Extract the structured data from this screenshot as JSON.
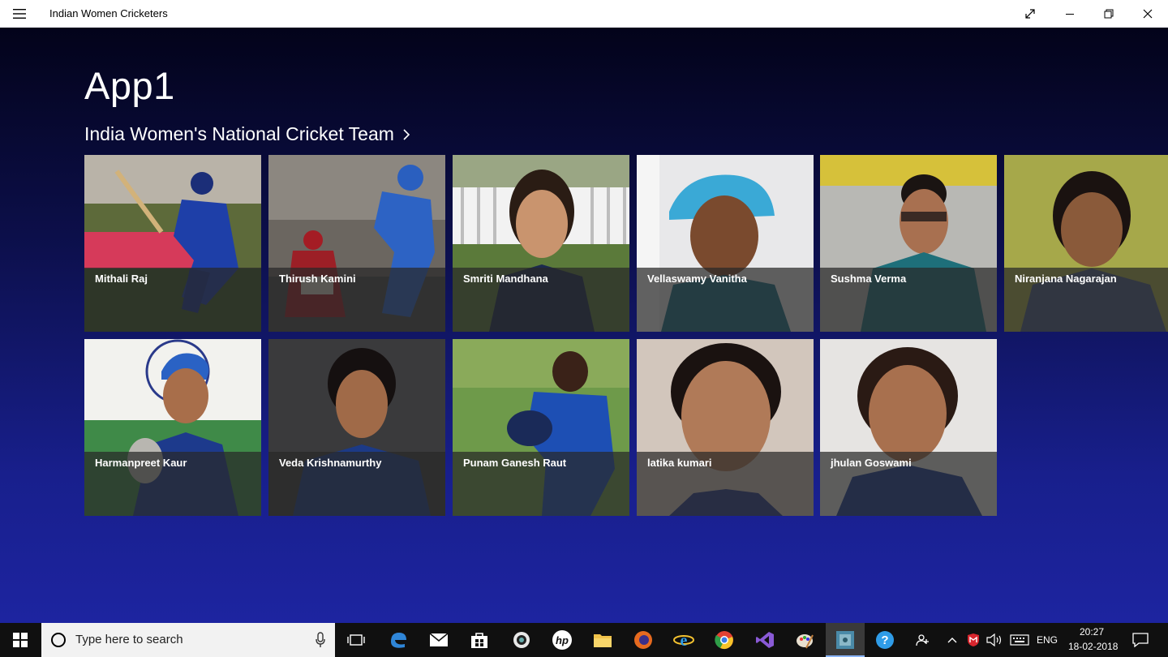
{
  "window": {
    "title": "Indian Women Cricketers"
  },
  "app": {
    "title": "App1",
    "section_title": "India Women's National Cricket Team"
  },
  "players": [
    {
      "name": "Mithali Raj"
    },
    {
      "name": "Thirush Kamini"
    },
    {
      "name": "Smriti Mandhana"
    },
    {
      "name": "Vellaswamy Vanitha"
    },
    {
      "name": "Sushma Verma"
    },
    {
      "name": "Niranjana Nagarajan"
    },
    {
      "name": "Harmanpreet Kaur"
    },
    {
      "name": "Veda Krishnamurthy"
    },
    {
      "name": "Punam Ganesh Raut"
    },
    {
      "name": "latika kumari"
    },
    {
      "name": "jhulan Goswami"
    }
  ],
  "taskbar": {
    "search_placeholder": "Type here to search",
    "language": "ENG",
    "time": "20:27",
    "date": "18-02-2018"
  },
  "icons": {
    "menu": "hamburger-icon",
    "maximize_toggle": "expand-icon",
    "minimize": "minimize-icon",
    "restore": "restore-icon",
    "close": "close-icon",
    "section_chevron": "chevron-right-icon"
  }
}
